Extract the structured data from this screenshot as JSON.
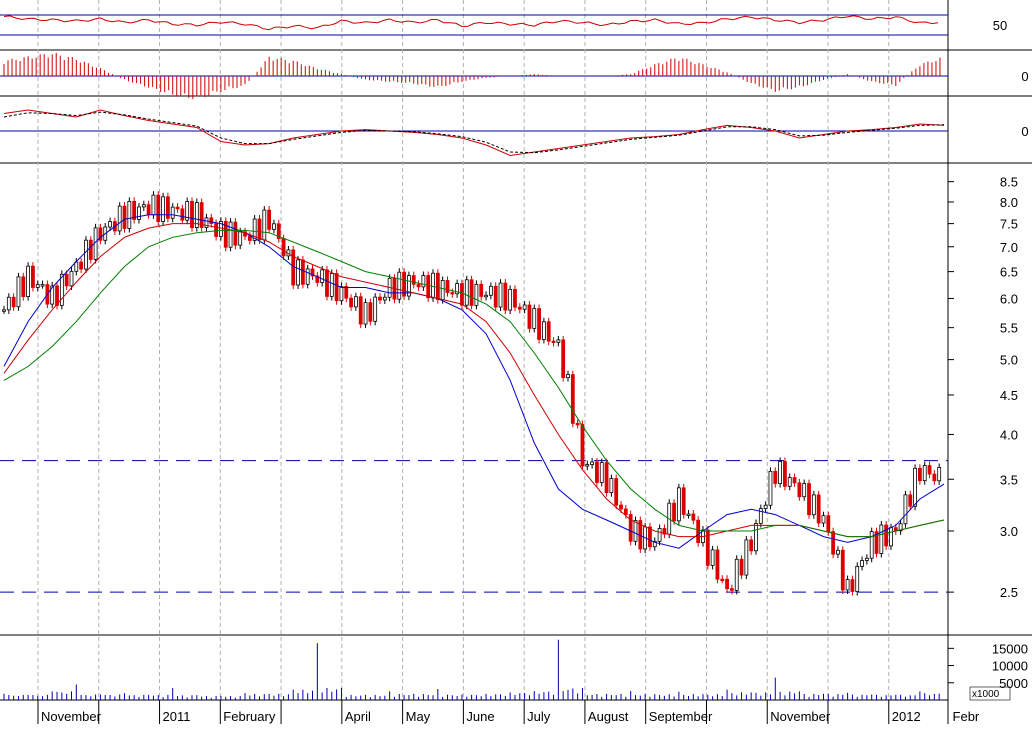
{
  "chart_data": [
    {
      "panel": "oscillator",
      "type": "line",
      "y_tick_labels": [
        "50"
      ],
      "y_ticks": [
        50
      ],
      "reference_lines": [
        70,
        30
      ],
      "ylim": [
        0,
        100
      ],
      "series": [
        {
          "color": "#cc0000",
          "values_sampled": [
            67,
            62,
            60,
            58,
            62,
            55,
            60,
            52,
            50,
            56,
            52,
            42,
            48,
            44,
            58,
            54,
            60,
            55,
            60,
            48,
            55,
            52,
            50,
            58,
            55,
            50,
            57,
            60,
            52,
            54,
            62,
            66,
            60,
            55,
            60,
            68,
            62,
            66,
            54,
            56
          ]
        }
      ]
    },
    {
      "panel": "momentum-histogram",
      "type": "bar",
      "y_tick_labels": [
        "0"
      ],
      "y_ticks": [
        0
      ],
      "series": [
        {
          "color": "#cc0000",
          "values_sampled": [
            0.8,
            1.0,
            1.2,
            0.9,
            0.4,
            -0.2,
            -0.6,
            -1.0,
            -1.2,
            -0.8,
            -0.5,
            1.0,
            0.8,
            0.4,
            0.1,
            -0.2,
            -0.3,
            -0.4,
            -0.6,
            -0.3,
            -0.1,
            0.0,
            0.1,
            0.0,
            0.0,
            0.0,
            0.1,
            0.6,
            1.0,
            0.6,
            0.2,
            -0.4,
            -0.8,
            -0.6,
            -0.2,
            0.1,
            -0.3,
            -0.5,
            0.6,
            1.0
          ]
        }
      ]
    },
    {
      "panel": "macd",
      "type": "line",
      "y_tick_labels": [
        "0"
      ],
      "y_ticks": [
        0
      ],
      "series": [
        {
          "color": "#cc0000",
          "values_sampled": [
            0.25,
            0.3,
            0.25,
            0.2,
            0.3,
            0.22,
            0.15,
            0.1,
            0.05,
            -0.15,
            -0.2,
            -0.18,
            -0.1,
            -0.05,
            0.0,
            0.02,
            0.0,
            -0.02,
            -0.05,
            -0.1,
            -0.2,
            -0.35,
            -0.3,
            -0.25,
            -0.2,
            -0.15,
            -0.1,
            -0.08,
            -0.05,
            0.02,
            0.08,
            0.05,
            0.0,
            -0.1,
            -0.05,
            0.0,
            0.02,
            0.05,
            0.1,
            0.08
          ]
        },
        {
          "color": "#000000",
          "dashed": true,
          "values_sampled": [
            0.2,
            0.26,
            0.25,
            0.22,
            0.27,
            0.23,
            0.17,
            0.12,
            0.07,
            -0.1,
            -0.18,
            -0.18,
            -0.12,
            -0.07,
            -0.02,
            0.01,
            0.0,
            -0.01,
            -0.04,
            -0.08,
            -0.16,
            -0.3,
            -0.31,
            -0.27,
            -0.22,
            -0.17,
            -0.12,
            -0.09,
            -0.06,
            0.0,
            0.06,
            0.06,
            0.02,
            -0.07,
            -0.06,
            -0.02,
            0.01,
            0.04,
            0.08,
            0.09
          ]
        }
      ]
    },
    {
      "panel": "price",
      "type": "line",
      "subtype": "candlestick",
      "y_scale": "log",
      "ylim": [
        2.2,
        8.8
      ],
      "y_ticks": [
        2.5,
        3.0,
        3.5,
        4.0,
        4.5,
        5.0,
        5.5,
        6.0,
        6.5,
        7.0,
        7.5,
        8.0,
        8.5
      ],
      "y_tick_labels": [
        "2.5",
        "3.0",
        "3.5",
        "4.0",
        "4.5",
        "5.0",
        "5.5",
        "6.0",
        "6.5",
        "7.0",
        "7.5",
        "8.0",
        "8.5"
      ],
      "horizontal_lines": [
        3.7,
        2.5
      ],
      "close_sampled": [
        5.8,
        6.4,
        6.0,
        6.6,
        7.3,
        7.7,
        7.9,
        7.8,
        7.7,
        7.3,
        7.2,
        7.6,
        6.5,
        6.4,
        6.1,
        5.7,
        6.2,
        6.3,
        6.2,
        6.1,
        6.1,
        6.0,
        5.6,
        5.2,
        3.7,
        3.5,
        3.0,
        2.9,
        3.3,
        2.9,
        2.5,
        2.9,
        3.6,
        3.4,
        3.1,
        2.5,
        2.9,
        3.0,
        3.6,
        3.5
      ],
      "series": [
        {
          "color": "#0000cc",
          "values_sampled": [
            4.9,
            5.6,
            6.2,
            6.7,
            7.2,
            7.6,
            7.7,
            7.7,
            7.6,
            7.5,
            7.3,
            7.0,
            6.6,
            6.4,
            6.2,
            6.2,
            6.1,
            6.1,
            6.0,
            5.8,
            5.4,
            4.7,
            3.9,
            3.4,
            3.2,
            3.1,
            3.0,
            2.9,
            2.85,
            3.0,
            3.15,
            3.2,
            3.15,
            3.05,
            2.95,
            2.9,
            2.95,
            3.05,
            3.3,
            3.45
          ]
        },
        {
          "color": "#cc0000",
          "values_sampled": [
            4.8,
            5.3,
            5.8,
            6.3,
            6.8,
            7.2,
            7.4,
            7.5,
            7.5,
            7.4,
            7.3,
            7.1,
            6.8,
            6.6,
            6.4,
            6.3,
            6.2,
            6.1,
            6.0,
            5.9,
            5.6,
            5.1,
            4.5,
            4.0,
            3.6,
            3.3,
            3.1,
            3.0,
            2.95,
            2.95,
            3.0,
            3.05,
            3.05,
            3.05,
            3.0,
            2.95,
            2.95,
            3.0,
            3.05,
            3.1
          ]
        },
        {
          "color": "#008000",
          "values_sampled": [
            4.7,
            4.9,
            5.2,
            5.6,
            6.1,
            6.6,
            7.0,
            7.2,
            7.3,
            7.35,
            7.35,
            7.3,
            7.1,
            6.9,
            6.7,
            6.5,
            6.4,
            6.3,
            6.2,
            6.1,
            5.9,
            5.6,
            5.1,
            4.6,
            4.1,
            3.7,
            3.4,
            3.2,
            3.05,
            3.0,
            3.0,
            3.0,
            3.05,
            3.05,
            3.0,
            2.95,
            2.95,
            3.0,
            3.05,
            3.1
          ]
        }
      ]
    },
    {
      "panel": "volume",
      "type": "bar",
      "y_ticks": [
        5000,
        10000,
        15000
      ],
      "y_tick_labels": [
        "5000",
        "10000",
        "15000"
      ],
      "unit_label": "x1000",
      "ylim": [
        0,
        18000
      ],
      "color": "#0000aa",
      "values_sampled": [
        1800,
        1500,
        2500,
        4500,
        1600,
        2000,
        1500,
        3500,
        1400,
        1200,
        2000,
        1800,
        3000,
        16500,
        3500,
        1500,
        2500,
        1800,
        3200,
        1600,
        1800,
        2200,
        2600,
        17500,
        3500,
        1800,
        2600,
        1700,
        2400,
        1700,
        3000,
        2200,
        6500,
        2500,
        1800,
        2100,
        1600,
        1500,
        2500,
        2000
      ]
    }
  ],
  "x_axis": {
    "labels": [
      "November",
      "2011",
      "February",
      "April",
      "May",
      "June",
      "July",
      "August",
      "September",
      "November",
      "2012",
      "Febr"
    ],
    "label_positions_months": [
      0,
      2,
      3,
      5,
      6,
      7,
      8,
      9,
      10,
      12,
      14,
      15
    ]
  }
}
